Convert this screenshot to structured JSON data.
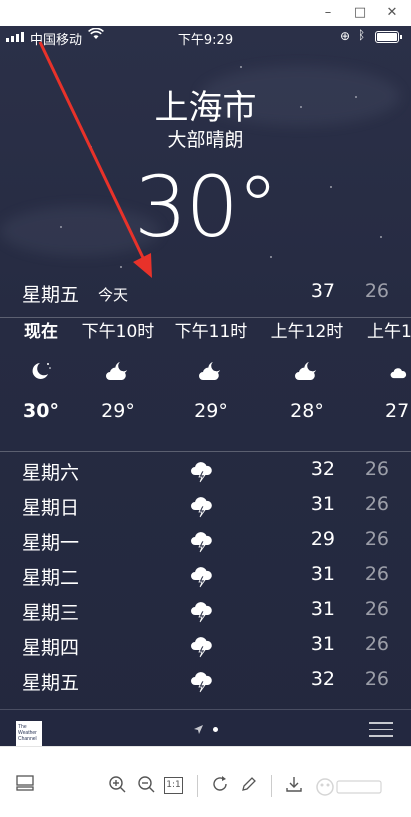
{
  "window": {
    "minimize": "–",
    "maximize": "□",
    "close": "✕"
  },
  "status_bar": {
    "carrier": "中国移动",
    "time": "下午9:29"
  },
  "location": {
    "city": "上海市",
    "condition": "大部晴朗",
    "temperature": "30°"
  },
  "today": {
    "day": "星期五",
    "tag": "今天",
    "high": "37",
    "low": "26"
  },
  "hourly": [
    {
      "time": "现在",
      "icon": "moon-cloud-icon",
      "temp": "30°"
    },
    {
      "time": "下午10时",
      "icon": "partly-cloudy-night-icon",
      "temp": "29°"
    },
    {
      "time": "下午11时",
      "icon": "partly-cloudy-night-icon",
      "temp": "29°"
    },
    {
      "time": "上午12时",
      "icon": "partly-cloudy-night-icon",
      "temp": "28°"
    },
    {
      "time": "上午1",
      "icon": "partly-cloudy-night-icon",
      "temp": "27"
    }
  ],
  "daily": [
    {
      "day": "星期六",
      "icon": "thunderstorm-icon",
      "high": "32",
      "low": "26"
    },
    {
      "day": "星期日",
      "icon": "thunderstorm-icon",
      "high": "31",
      "low": "26"
    },
    {
      "day": "星期一",
      "icon": "thunderstorm-icon",
      "high": "29",
      "low": "26"
    },
    {
      "day": "星期二",
      "icon": "thunderstorm-icon",
      "high": "31",
      "low": "26"
    },
    {
      "day": "星期三",
      "icon": "thunderstorm-icon",
      "high": "31",
      "low": "26"
    },
    {
      "day": "星期四",
      "icon": "thunderstorm-icon",
      "high": "31",
      "low": "26"
    },
    {
      "day": "星期五",
      "icon": "thunderstorm-icon",
      "high": "32",
      "low": "26"
    }
  ],
  "footer": {
    "logo_lines": [
      "The",
      "Weather",
      "Channel"
    ]
  },
  "toolbar": {
    "fit_label": "1:1"
  },
  "colors": {
    "sky_top": "#2b3048",
    "sky_bottom": "#23283e",
    "annotation_arrow": "#e8322a",
    "text": "#ffffff"
  }
}
